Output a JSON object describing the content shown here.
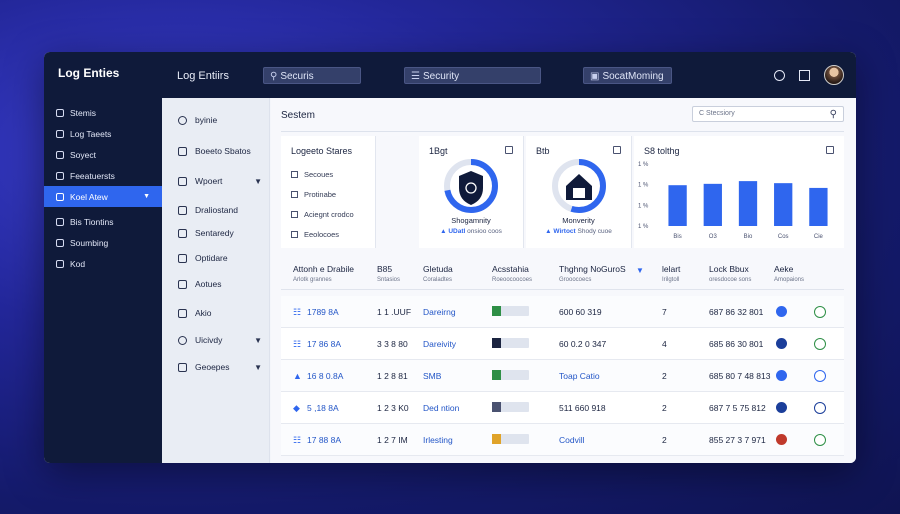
{
  "app": {
    "title": "Log Enties"
  },
  "topbar": {
    "title": "Log Entiirs",
    "search1": "Securis",
    "search2": "Security",
    "search3": "SocatMoming"
  },
  "sidebar": {
    "items": [
      {
        "label": "Stemis"
      },
      {
        "label": "Log Taeets"
      },
      {
        "label": "Soyect"
      },
      {
        "label": "Feeatuersts"
      },
      {
        "label": "Koel Atew",
        "active": true
      },
      {
        "label": "Bis Tiontins"
      },
      {
        "label": "Soumbing"
      },
      {
        "label": "Kod"
      }
    ]
  },
  "subnav": {
    "items": [
      {
        "label": "byinie"
      },
      {
        "label": "Boeeto Sbatos"
      },
      {
        "label": "Wpoert"
      },
      {
        "label": "Draliostand"
      },
      {
        "label": "Sentaredy"
      },
      {
        "label": "Optidare"
      },
      {
        "label": "Aotues"
      },
      {
        "label": "Akio"
      },
      {
        "label": "Uicivdy"
      },
      {
        "label": "Geoepes"
      }
    ]
  },
  "main": {
    "title": "Sestem",
    "search_placeholder": "C Stecsiory"
  },
  "cards": {
    "filters": {
      "title": "Logeeto Stares",
      "options": [
        "Secoues",
        "Protinabe",
        "Aciegnt crodco",
        "Eeolocoes"
      ]
    },
    "donut1": {
      "title": "1Bgt",
      "label": "Shogamnity",
      "sub_prefix": "▲ UDatl",
      "sub_rest": "onsioo coos",
      "value": 0.72,
      "color": "#2f66ee"
    },
    "donut2": {
      "title": "Btb",
      "label": "Monverity",
      "sub_prefix": "▲ Wirtoct",
      "sub_rest": "Shody cuoe",
      "value": 0.55,
      "color": "#2f66ee"
    },
    "bars": {
      "title": "S8 tolthg",
      "y_ticks": [
        "1 %",
        "1 %",
        "1 %",
        "1 %"
      ],
      "categories": [
        "Bis",
        "O3",
        "Bio",
        "Cos",
        "Cie"
      ]
    }
  },
  "chart_data": {
    "type": "bar",
    "title": "S8 tolthg",
    "categories": [
      "Bis",
      "O3",
      "Bio",
      "Cos",
      "Cie"
    ],
    "values": [
      60,
      62,
      66,
      63,
      56
    ],
    "ylim": [
      0,
      100
    ],
    "color": "#2f66ee"
  },
  "table": {
    "headers": [
      {
        "label": "Attonh e Drabile",
        "sub": "Arlotk grannes"
      },
      {
        "label": "B85",
        "sub": "Sntasios"
      },
      {
        "label": "Gletuda",
        "sub": "Coraladtes"
      },
      {
        "label": "Acsstahia",
        "sub": "Roeoocoocoes"
      },
      {
        "label": "Thghng NoGuroS",
        "sub": "Grooocoecs"
      },
      {
        "label": "lelart",
        "sub": "Irilgtoll"
      },
      {
        "label": "Lock Bbux",
        "sub": "oresdocoe sons"
      },
      {
        "label": "Aeke",
        "sub": "Amopaions"
      }
    ],
    "rows": [
      {
        "id": "1789 8A",
        "num": "1 1 .UUF",
        "type": "Dareirng",
        "tag_color": "#2e8f46",
        "code": "600 60 319",
        "count": "7",
        "lock": "687 86 32 801",
        "d1": "#2f66ee",
        "d2": "#2e8f46"
      },
      {
        "id": "17 86 8A",
        "num": "3 3 8 80",
        "type": "Dareivity",
        "tag_color": "#1b2440",
        "code": "60 0.2 0 347",
        "count": "4",
        "lock": "685 86 30 801",
        "d1": "#1b3e9a",
        "d2": "#2e8f46"
      },
      {
        "id": "16 8 0.8A",
        "num": "1 2 8 81",
        "type": "SMB",
        "tag_color": "#2e8f46",
        "code": "Toap Catio",
        "count": "2",
        "lock": "685 80 7 48 813",
        "d1": "#2f66ee",
        "d2": "#2f66ee"
      },
      {
        "id": "5 ,18 8A",
        "num": "1 2 3 K0",
        "type": "Ded ntion",
        "tag_color": "#4a5270",
        "code": "511 660 918",
        "count": "2",
        "lock": "687 7 5 75 812",
        "d1": "#1b3e9a",
        "d2": "#1b3e9a"
      },
      {
        "id": "17 88 8A",
        "num": "1 2 7 IM",
        "type": "Irlesting",
        "tag_color": "#e0a329",
        "code": "Codvill",
        "count": "2",
        "lock": "855 27 3 7 971",
        "d1": "#c0392b",
        "d2": "#2e8f46"
      }
    ]
  }
}
